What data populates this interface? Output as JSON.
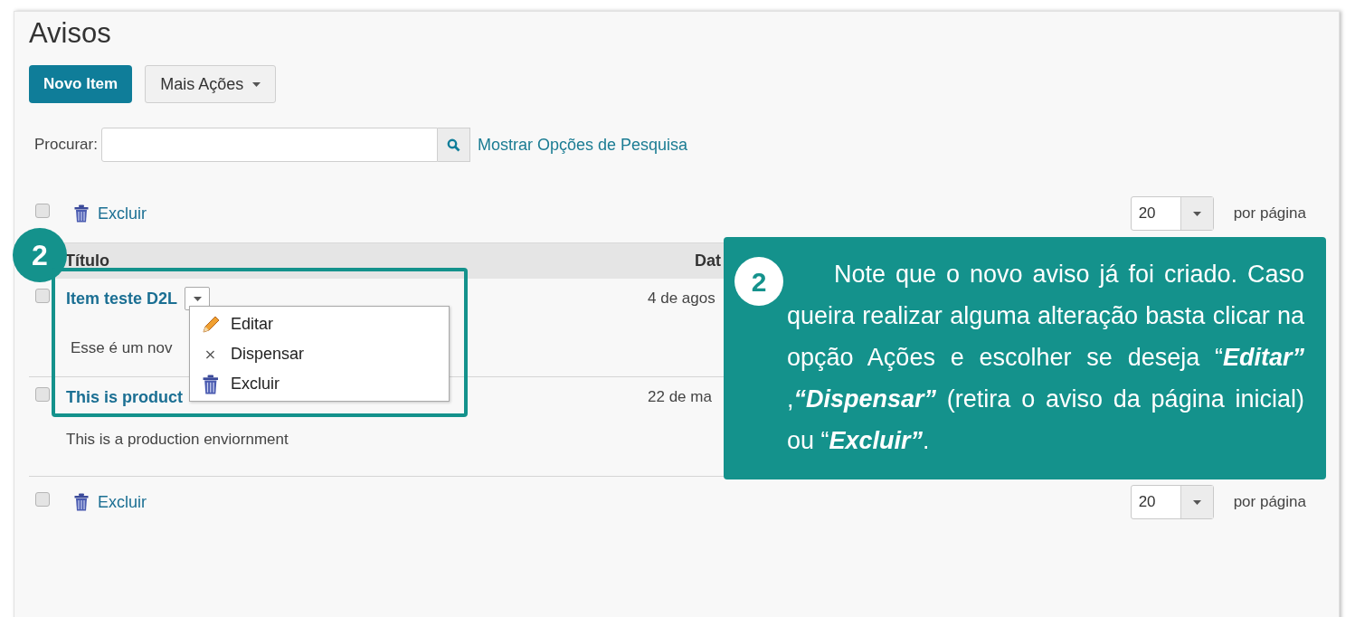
{
  "page": {
    "title": "Avisos"
  },
  "toolbar": {
    "buttons": [
      {
        "label": "Novo Item",
        "kind": "primary"
      },
      {
        "label": "Mais Ações",
        "kind": "dropdown"
      }
    ]
  },
  "search": {
    "label": "Procurar:",
    "link": "Mostrar Opções de Pesquisa"
  },
  "top_actions": {
    "checked": false,
    "delete": "Excluir",
    "page_size": "20",
    "per_page": "por página"
  },
  "table": {
    "columns": [
      "Título",
      "Dat"
    ],
    "rows": [
      {
        "title": "Item teste D2L",
        "date": "4 de agos",
        "description": "Esse é um nov",
        "checked": false
      },
      {
        "title": "This is product",
        "date": "22 de ma",
        "description": "This is a production enviornment",
        "checked": false
      }
    ]
  },
  "row_menu": {
    "items": [
      {
        "label": "Editar",
        "kind": "edit"
      },
      {
        "label": "Dispensar",
        "kind": "dismiss",
        "icon": "×"
      },
      {
        "label": "Excluir",
        "kind": "delete"
      }
    ]
  },
  "bottom_actions": {
    "checked": false,
    "delete": "Excluir",
    "page_size": "20",
    "per_page": "por página"
  },
  "step_badge": "2",
  "callout": {
    "step": "2",
    "text": "Note que o novo aviso já foi criado. Caso queira realizar alguma alteração basta clicar na opção Ações e escolher se deseja “**Editar”** ,**“Dispensar”** (retira o aviso da página inicial) ou “**Excluir”**."
  }
}
